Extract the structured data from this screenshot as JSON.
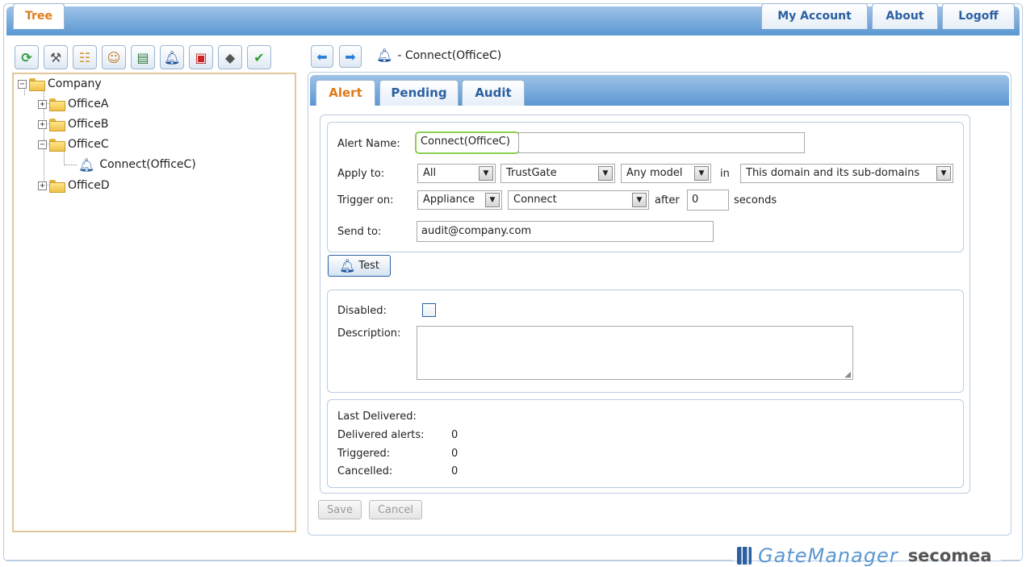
{
  "header": {
    "tree_tab": "Tree",
    "my_account": "My Account",
    "about": "About",
    "logoff": "Logoff"
  },
  "toolbar": {
    "icons": [
      "refresh-icon",
      "tools-icon",
      "hierarchy-icon",
      "user-icon",
      "report-icon",
      "alert-icon",
      "toolbox-icon",
      "disk-icon",
      "license-icon"
    ]
  },
  "tree": {
    "root": "Company",
    "items": [
      "OfficeA",
      "OfficeB",
      "OfficeC",
      "OfficeD"
    ],
    "alert_item": "Connect(OfficeC)"
  },
  "breadcrumb": {
    "text": "- Connect(OfficeC)"
  },
  "tabs": {
    "alert": "Alert",
    "pending": "Pending",
    "audit": "Audit"
  },
  "form": {
    "alert_name_label": "Alert Name:",
    "alert_name_value": "Connect(OfficeC)",
    "apply_to_label": "Apply to:",
    "apply_all": "All",
    "apply_product": "TrustGate",
    "apply_model": "Any model",
    "in_label": "in",
    "apply_domain": "This domain and its sub-domains",
    "trigger_label": "Trigger on:",
    "trigger_source": "Appliance",
    "trigger_event": "Connect",
    "after_label": "after",
    "after_value": "0",
    "seconds_label": "seconds",
    "send_to_label": "Send to:",
    "send_to_value": "audit@company.com",
    "test_button": "Test",
    "disabled_label": "Disabled:",
    "disabled_checked": false,
    "description_label": "Description:",
    "description_value": ""
  },
  "stats": {
    "last_delivered_label": "Last Delivered:",
    "last_delivered_value": "",
    "delivered_label": "Delivered alerts:",
    "delivered_value": "0",
    "triggered_label": "Triggered:",
    "triggered_value": "0",
    "cancelled_label": "Cancelled:",
    "cancelled_value": "0"
  },
  "actions": {
    "save": "Save",
    "cancel": "Cancel"
  },
  "branding": {
    "product": "GateManager",
    "vendor": "secomea"
  }
}
